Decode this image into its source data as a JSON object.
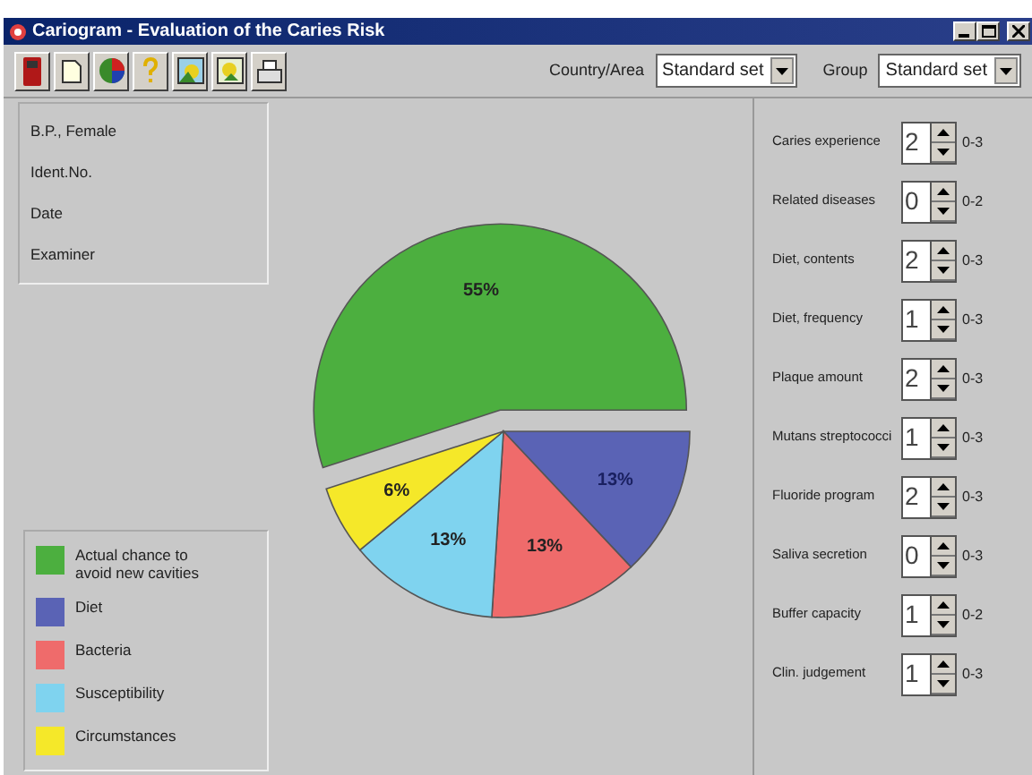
{
  "window": {
    "title": "Cariogram - Evaluation of the Caries Risk"
  },
  "selectors": [
    {
      "label": "Country/Area",
      "value": "Standard set"
    },
    {
      "label": "Group",
      "value": "Standard set"
    }
  ],
  "patient_info": [
    "B.P., Female",
    "Ident.No.",
    "Date",
    "Examiner"
  ],
  "chart": {
    "chart_data": {
      "type": "pie",
      "values": [
        55,
        13,
        13,
        13,
        6
      ],
      "value_labels": [
        "55%",
        "13%",
        "13%",
        "13%",
        "6%"
      ]
    }
  },
  "legend": [
    {
      "label": "Actual chance to avoid new cavities",
      "color": "#4caf3f"
    },
    {
      "label": "Diet",
      "color": "#5a63b5"
    },
    {
      "label": "Bacteria",
      "color": "#ef6b6b"
    },
    {
      "label": "Susceptibility",
      "color": "#7fd3ef"
    },
    {
      "label": "Circumstances",
      "color": "#f5e829"
    }
  ],
  "factors": [
    {
      "label": "Caries experience",
      "value": "2",
      "range": "0-3"
    },
    {
      "label": "Related diseases",
      "value": "0",
      "range": "0-2"
    },
    {
      "label": "Diet, contents",
      "value": "2",
      "range": "0-3"
    },
    {
      "label": "Diet, frequency",
      "value": "1",
      "range": "0-3"
    },
    {
      "label": "Plaque amount",
      "value": "2",
      "range": "0-3"
    },
    {
      "label": "Mutans streptococci",
      "value": "1",
      "range": "0-3"
    },
    {
      "label": "Fluoride program",
      "value": "2",
      "range": "0-3"
    },
    {
      "label": "Saliva secretion",
      "value": "0",
      "range": "0-3"
    },
    {
      "label": "Buffer capacity",
      "value": "1",
      "range": "0-2"
    },
    {
      "label": "Clin. judgement",
      "value": "1",
      "range": "0-3"
    }
  ]
}
